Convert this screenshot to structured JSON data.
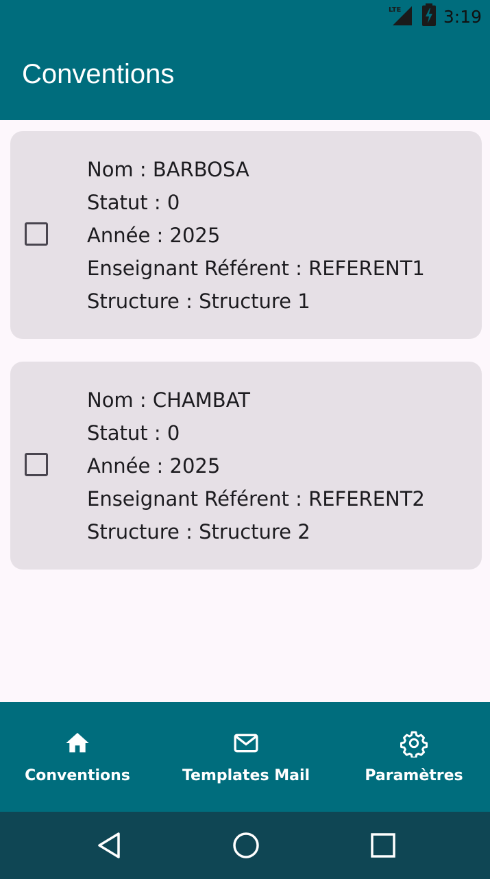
{
  "status_bar": {
    "time": "3:19",
    "network_label": "LTE",
    "icons": [
      "lte-signal-icon",
      "battery-charging-icon"
    ]
  },
  "app_bar": {
    "title": "Conventions"
  },
  "conventions": [
    {
      "checked": false,
      "fields": [
        "Nom : BARBOSA",
        "Statut : 0",
        "Année : 2025",
        "Enseignant Référent : REFERENT1",
        "Structure : Structure 1"
      ]
    },
    {
      "checked": false,
      "fields": [
        "Nom : CHAMBAT",
        "Statut : 0",
        "Année : 2025",
        "Enseignant Référent : REFERENT2",
        "Structure : Structure 2"
      ]
    }
  ],
  "bottom_nav": {
    "items": [
      {
        "label": "Conventions",
        "icon": "home-icon",
        "selected": true
      },
      {
        "label": "Templates Mail",
        "icon": "mail-icon",
        "selected": false
      },
      {
        "label": "Paramètres",
        "icon": "gear-icon",
        "selected": false
      }
    ]
  },
  "system_nav": {
    "icons": [
      "back-icon",
      "home-circle-icon",
      "recents-icon"
    ]
  },
  "colors": {
    "primary": "#006d7d",
    "background": "#fdf7fc",
    "card": "#e6e0e6",
    "system_nav": "#0f4654",
    "text": "#1c1b1f"
  }
}
